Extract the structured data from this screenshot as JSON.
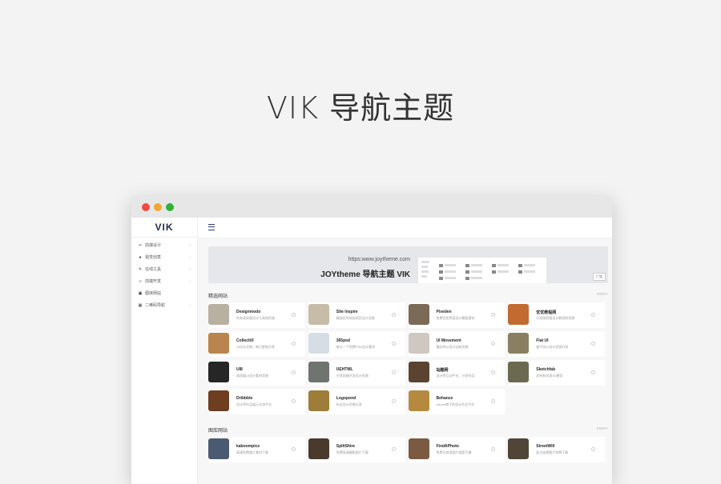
{
  "hero": {
    "title": "VIK 导航主题"
  },
  "sidebar": {
    "logo": "VIK",
    "items": [
      {
        "label": "前端设计",
        "icon": "scissors-icon",
        "glyph": "✂",
        "has_chevron": true
      },
      {
        "label": "视觉创意",
        "icon": "droplet-icon",
        "glyph": "●",
        "has_chevron": true
      },
      {
        "label": "在线工具",
        "icon": "pen-icon",
        "glyph": "✎",
        "has_chevron": true
      },
      {
        "label": "前端开发",
        "icon": "code-icon",
        "glyph": "‹›",
        "has_chevron": true
      },
      {
        "label": "图库网站",
        "icon": "image-icon",
        "glyph": "▣",
        "has_chevron": false
      },
      {
        "label": "二维码导航",
        "icon": "grid-icon",
        "glyph": "▦",
        "has_chevron": true
      }
    ]
  },
  "banner": {
    "url": "https:www.joytheme.com",
    "title": "JOYtheme 导航主题 VIK",
    "ad": "广告"
  },
  "sections": [
    {
      "title": "精选网站",
      "more": "more+",
      "cards": [
        {
          "name": "Designmodo",
          "desc": "所有高质量设计工具和资源",
          "color": "#b8b0a0"
        },
        {
          "name": "Site Inspire",
          "desc": "精选优秀网站网页设计灵感",
          "color": "#c7bca8"
        },
        {
          "name": "Pixeden",
          "desc": "免费优质界面设计模板素材",
          "color": "#7b6a55"
        },
        {
          "name": "优优教程网",
          "desc": "分享高质量设计教程和资源",
          "color": "#c26a2f"
        },
        {
          "name": "CollectUI",
          "desc": "UI设计灵感，每日更新分享",
          "color": "#b9844e"
        },
        {
          "name": "365psd",
          "desc": "每天一个免费PSD设计素材",
          "color": "#d7dde4"
        },
        {
          "name": "UI Movement",
          "desc": "最好的UI设计动效灵感",
          "color": "#cfc8c0"
        },
        {
          "name": "Flat UI",
          "desc": "扁平化UI设计资源分享",
          "color": "#8a7f60"
        },
        {
          "name": "UI8",
          "desc": "高质量UI设计素材资源",
          "color": "#262626"
        },
        {
          "name": "UEHTML",
          "desc": "分享前端开发设计资源",
          "color": "#6f7470"
        },
        {
          "name": "站酷网",
          "desc": "设计师互动平台，分享作品",
          "color": "#5a4430"
        },
        {
          "name": "Sketchfab",
          "desc": "发布和发现3D模型",
          "color": "#6b6a50"
        },
        {
          "name": "Dribbble",
          "desc": "设计师作品展示交流平台",
          "color": "#6d3e20"
        },
        {
          "name": "Logopond",
          "desc": "标志设计灵感分享",
          "color": "#9e7d3a"
        },
        {
          "name": "Behance",
          "desc": "Adobe旗下的设计作品平台",
          "color": "#b58a3f"
        }
      ]
    },
    {
      "title": "图库网站",
      "more": "more+",
      "cards": [
        {
          "name": "kaboompics",
          "desc": "高清免费图片素材下载",
          "color": "#4a5a70"
        },
        {
          "name": "SplitShire",
          "desc": "免费高清摄影图片下载",
          "color": "#4a3a2c"
        },
        {
          "name": "FindAPhoto",
          "desc": "免费可商用图片搜索引擎",
          "color": "#7a5a40"
        },
        {
          "name": "StreetWill",
          "desc": "复古街景图片免费下载",
          "color": "#504536"
        }
      ]
    }
  ]
}
